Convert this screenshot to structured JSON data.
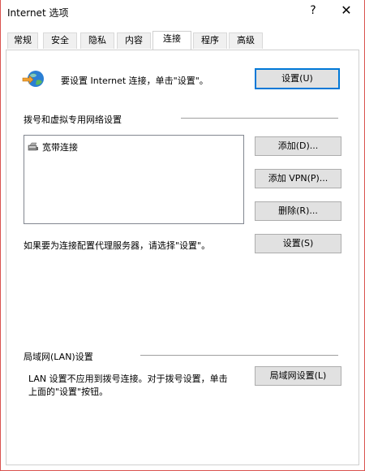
{
  "window": {
    "title": "Internet 选项",
    "help_glyph": "?",
    "close_glyph": "✕"
  },
  "tabs": [
    {
      "label": "常规"
    },
    {
      "label": "安全"
    },
    {
      "label": "隐私"
    },
    {
      "label": "内容"
    },
    {
      "label": "连接"
    },
    {
      "label": "程序"
    },
    {
      "label": "高级"
    }
  ],
  "active_tab": "连接",
  "setup": {
    "icon": "internet-globe-icon",
    "text": "要设置 Internet 连接，单击\"设置\"。",
    "button": "设置(U)"
  },
  "dialup": {
    "heading": "拨号和虚拟专用网络设置",
    "connections": [
      {
        "icon": "broadband-connection-icon",
        "label": "宽带连接"
      }
    ],
    "add_button": "添加(D)...",
    "add_vpn_button": "添加 VPN(P)...",
    "delete_button": "删除(R)...",
    "proxy_text": "如果要为连接配置代理服务器，请选择\"设置\"。",
    "settings_button": "设置(S)"
  },
  "lan": {
    "heading": "局域网(LAN)设置",
    "text_line1": "LAN 设置不应用到拨号连接。对于拨号设置，单击",
    "text_line2": "上面的\"设置\"按钮。",
    "button": "局域网设置(L)"
  }
}
